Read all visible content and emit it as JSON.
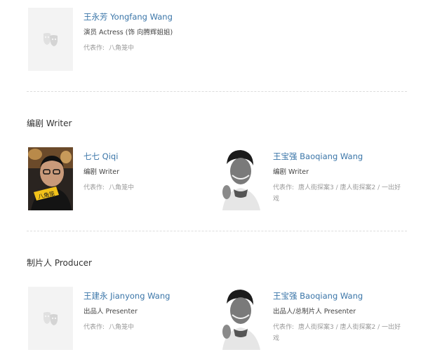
{
  "top_cast": {
    "name": "王永芳 Yongfang Wang",
    "role": "演员 Actress (饰 向腾辉姐姐)",
    "works_label": "代表作:",
    "works": "八角笼中",
    "photo_icon": "mask-placeholder-icon"
  },
  "sections": [
    {
      "title": "编剧 Writer",
      "people": [
        {
          "name": "七七 Qiqi",
          "role": "编剧 Writer",
          "works_label": "代表作:",
          "works": "八角笼中",
          "photo_icon": "person-photo"
        },
        {
          "name": "王宝强 Baoqiang Wang",
          "role": "编剧 Writer",
          "works_label": "代表作:",
          "works": "唐人街探案3 / 唐人街探案2 / 一出好戏",
          "photo_icon": "person-photo"
        }
      ]
    },
    {
      "title": "制片人 Producer",
      "people": [
        {
          "name": "王建永 Jianyong Wang",
          "role": "出品人 Presenter",
          "works_label": "代表作:",
          "works": "八角笼中",
          "photo_icon": "mask-placeholder-icon"
        },
        {
          "name": "王宝强 Baoqiang Wang",
          "role": "出品人/总制片人 Presenter",
          "works_label": "代表作:",
          "works": "唐人街探案3 / 唐人街探案2 / 一出好戏",
          "photo_icon": "person-photo"
        }
      ]
    }
  ]
}
